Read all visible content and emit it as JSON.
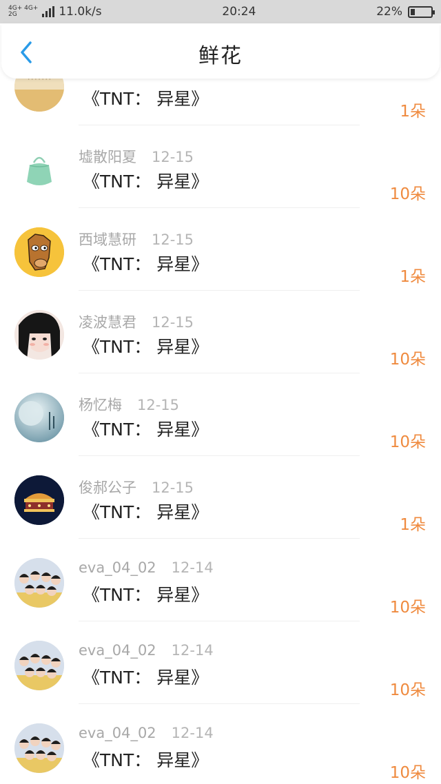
{
  "status_bar": {
    "network_top": "4G+ 4G+",
    "network_bottom": "2G",
    "speed": "11.0k/s",
    "time": "20:24",
    "battery": "22%",
    "battery_level": 0.22
  },
  "header": {
    "title": "鲜花",
    "back_icon": "chevron-left-icon",
    "accent_color": "#2a9be8"
  },
  "records": [
    {
      "name": "",
      "date": "",
      "book": "《TNT： 异星》",
      "amount": "1朵",
      "avatar": "scenery-text"
    },
    {
      "name": "墟散阳夏",
      "date": "12-15",
      "book": "《TNT： 异星》",
      "amount": "10朵",
      "avatar": "green-bag"
    },
    {
      "name": "西域慧研",
      "date": "12-15",
      "book": "《TNT： 异星》",
      "amount": "1朵",
      "avatar": "cartoon-horse"
    },
    {
      "name": "凌波慧君",
      "date": "12-15",
      "book": "《TNT： 异星》",
      "amount": "10朵",
      "avatar": "anime-girl"
    },
    {
      "name": "杨忆梅",
      "date": "12-15",
      "book": "《TNT： 异星》",
      "amount": "10朵",
      "avatar": "moon"
    },
    {
      "name": "俊郝公子",
      "date": "12-15",
      "book": "《TNT： 异星》",
      "amount": "1朵",
      "avatar": "carousel-night"
    },
    {
      "name": "eva_04_02",
      "date": "12-14",
      "book": "《TNT： 异星》",
      "amount": "10朵",
      "avatar": "group-photo"
    },
    {
      "name": "eva_04_02",
      "date": "12-14",
      "book": "《TNT： 异星》",
      "amount": "10朵",
      "avatar": "group-photo"
    },
    {
      "name": "eva_04_02",
      "date": "12-14",
      "book": "《TNT： 异星》",
      "amount": "10朵",
      "avatar": "group-photo"
    }
  ],
  "colors": {
    "amount": "#ef8a3e",
    "name": "#a8a8a8",
    "status_bar_bg": "#d9d9d9"
  }
}
